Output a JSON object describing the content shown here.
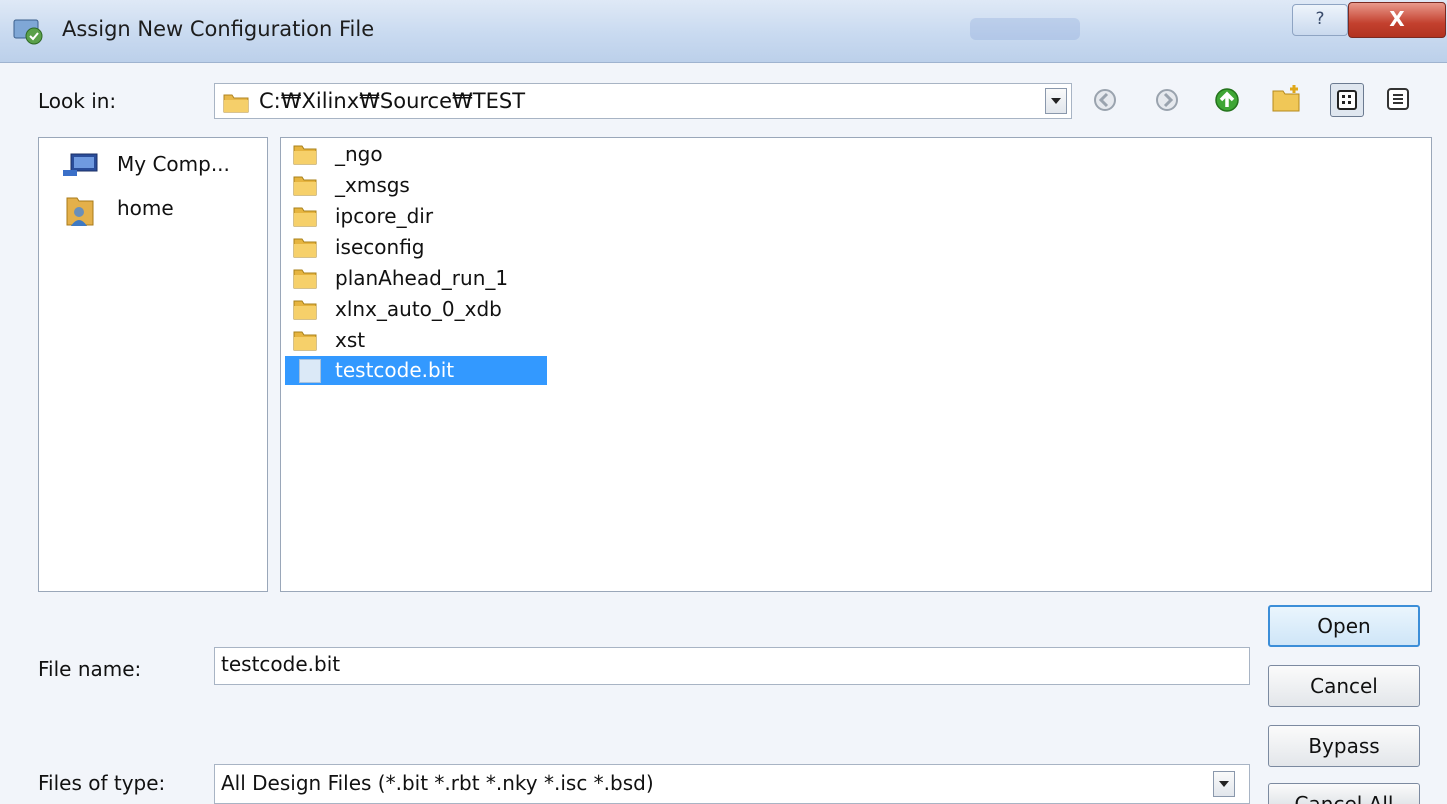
{
  "window": {
    "title": "Assign New Configuration File",
    "help_label": "?",
    "close_label": "X"
  },
  "look_in": {
    "label": "Look in:",
    "path": "C:₩Xilinx₩Source₩TEST"
  },
  "toolbar": {
    "icons": [
      "back-icon",
      "forward-icon",
      "up-folder-icon",
      "new-folder-icon",
      "list-view-icon",
      "detail-view-icon"
    ]
  },
  "sidebar": {
    "items": [
      {
        "label": "My Comp...",
        "icon": "computer-icon"
      },
      {
        "label": "home",
        "icon": "user-folder-icon"
      }
    ]
  },
  "files": {
    "items": [
      {
        "name": "_ngo",
        "type": "folder"
      },
      {
        "name": "_xmsgs",
        "type": "folder"
      },
      {
        "name": "ipcore_dir",
        "type": "folder"
      },
      {
        "name": "iseconfig",
        "type": "folder"
      },
      {
        "name": "planAhead_run_1",
        "type": "folder"
      },
      {
        "name": "xlnx_auto_0_xdb",
        "type": "folder"
      },
      {
        "name": "xst",
        "type": "folder"
      },
      {
        "name": "testcode.bit",
        "type": "file",
        "selected": true
      }
    ]
  },
  "file_name": {
    "label": "File name:",
    "value": "testcode.bit"
  },
  "file_type": {
    "label": "Files of type:",
    "value": "All Design Files (*.bit *.rbt *.nky *.isc *.bsd)"
  },
  "buttons": {
    "open": "Open",
    "cancel": "Cancel",
    "bypass": "Bypass",
    "cancel_all": "Cancel All"
  },
  "colors": {
    "selection": "#3399ff",
    "title_bar": "#c9daf0",
    "close_button": "#c3402e"
  }
}
